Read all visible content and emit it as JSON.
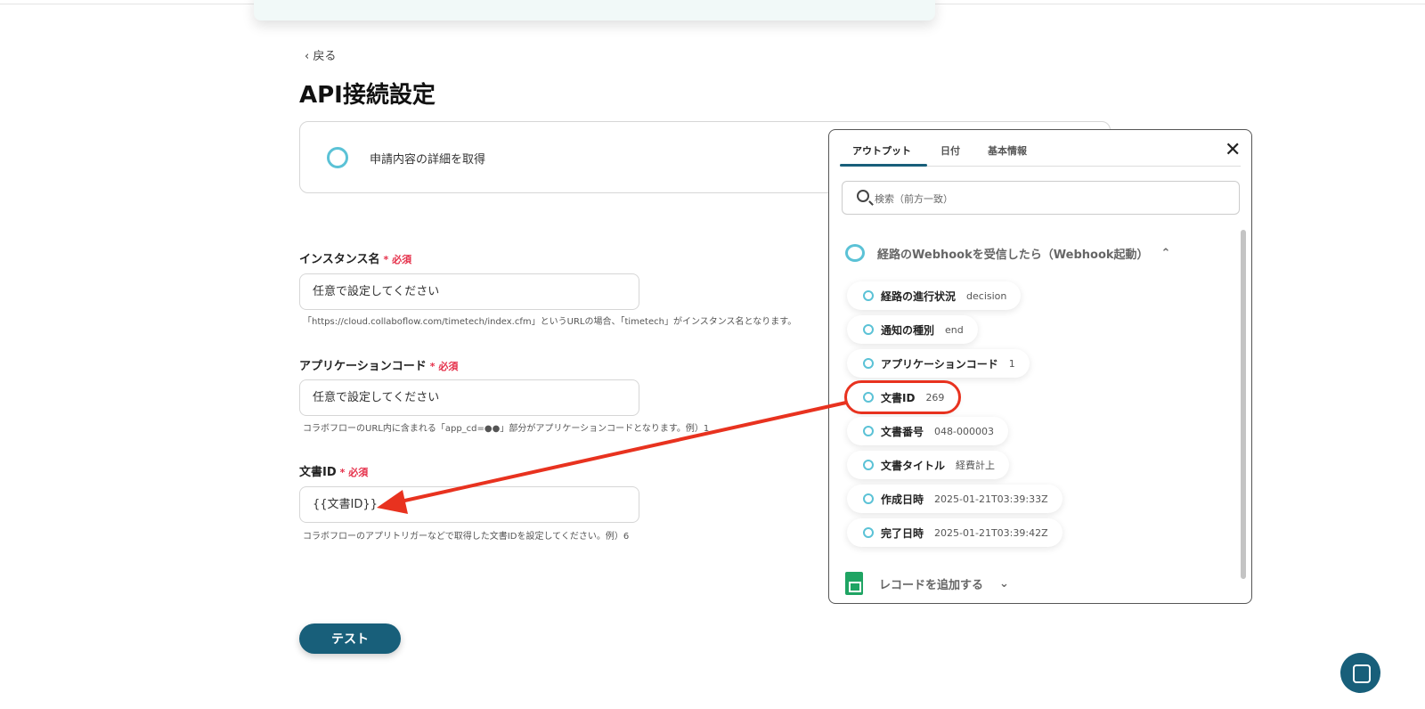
{
  "back": "戻る",
  "title": "API接続設定",
  "card_title": "申請内容の詳細を取得",
  "fields": [
    {
      "label": "インスタンス名",
      "required": "必須",
      "value": "任意で設定してください",
      "help": "「https://cloud.collaboflow.com/timetech/index.cfm」というURLの場合、「timetech」がインスタンス名となります。"
    },
    {
      "label": "アプリケーションコード",
      "required": "必須",
      "value": "任意で設定してください",
      "help": "コラボフローのURL内に含まれる「app_cd=●●」部分がアプリケーションコードとなります。例）1"
    },
    {
      "label": "文書ID",
      "required": "必須",
      "value": "{{文書ID}}",
      "help": "コラボフローのアプリトリガーなどで取得した文書IDを設定してください。例）6"
    }
  ],
  "test_button": "テスト",
  "popup": {
    "tabs": [
      "アウトプット",
      "日付",
      "基本情報"
    ],
    "search_placeholder": "検索（前方一致）",
    "group1": "経路のWebhookを受信したら（Webhook起動）",
    "items": [
      {
        "key": "経路の進行状況",
        "value": "decision"
      },
      {
        "key": "通知の種別",
        "value": "end"
      },
      {
        "key": "アプリケーションコード",
        "value": "1"
      },
      {
        "key": "文書ID",
        "value": "269"
      },
      {
        "key": "文書番号",
        "value": "048-000003"
      },
      {
        "key": "文書タイトル",
        "value": "経費計上"
      },
      {
        "key": "作成日時",
        "value": "2025-01-21T03:39:33Z"
      },
      {
        "key": "完了日時",
        "value": "2025-01-21T03:39:42Z"
      }
    ],
    "group2": "レコードを追加する"
  },
  "colors": {
    "accent": "#185f7a",
    "required": "#e5304a",
    "annotation": "#e8321f"
  }
}
